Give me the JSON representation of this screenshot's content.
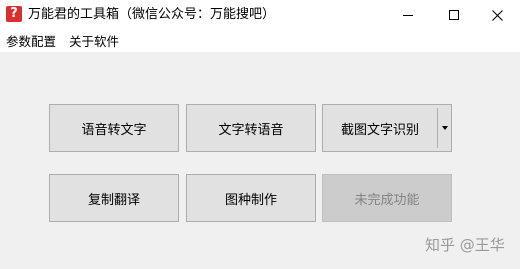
{
  "window": {
    "title": "万能君的工具箱（微信公众号：万能搜吧）",
    "icon_glyph": "?",
    "icon_color": "#d92f2f"
  },
  "menu": {
    "items": [
      {
        "label": "参数配置"
      },
      {
        "label": "关于软件"
      }
    ]
  },
  "buttons": {
    "speech_to_text": "语音转文字",
    "text_to_speech": "文字转语音",
    "screenshot_ocr": "截图文字识别",
    "copy_translate": "复制翻译",
    "image_maker": "图种制作",
    "unfinished": "未完成功能"
  },
  "watermark": "知乎 @王华",
  "colors": {
    "client_bg": "#f0f0f0",
    "button_bg": "#e1e1e1",
    "button_border": "#adadad",
    "disabled_bg": "#cccccc",
    "disabled_text": "#838383"
  }
}
